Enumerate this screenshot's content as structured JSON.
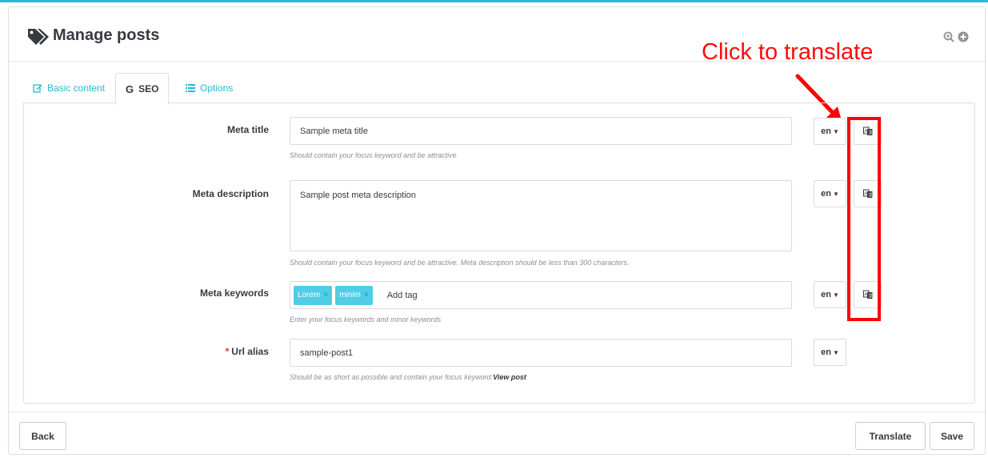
{
  "header": {
    "title": "Manage posts",
    "title_icon": "tags-icon",
    "actions": [
      {
        "icon": "zoom-icon"
      },
      {
        "icon": "plus-circle-icon"
      }
    ]
  },
  "annotation": {
    "text": "Click to translate",
    "color": "#ff0a0a"
  },
  "tabs": [
    {
      "label": "Basic content",
      "icon": "edit-icon",
      "active": false
    },
    {
      "label": "SEO",
      "icon": "google-icon",
      "active": true
    },
    {
      "label": "Options",
      "icon": "list-icon",
      "active": false
    }
  ],
  "fields": {
    "meta_title": {
      "label": "Meta title",
      "value": "Sample meta title",
      "help": "Should contain your focus keyword and be attractive",
      "lang": "en"
    },
    "meta_description": {
      "label": "Meta description",
      "value": "Sample post meta description",
      "help": "Should contain your focus keyword and be attractive. Meta description should be less than 300 characters.",
      "lang": "en"
    },
    "meta_keywords": {
      "label": "Meta keywords",
      "tags": [
        "Lorem",
        "minim"
      ],
      "placeholder": "Add tag",
      "help": "Enter your focus keywords and minor keywords",
      "lang": "en"
    },
    "url_alias": {
      "label": "Url alias",
      "required_mark": "*",
      "value": "sample-post1",
      "help": "Should be as short as possible and contain your focus keyword.",
      "help_link": "View post",
      "lang": "en"
    }
  },
  "footer": {
    "back_label": "Back",
    "translate_label": "Translate",
    "save_label": "Save"
  },
  "colors": {
    "accent": "#25b9d7",
    "tag_bg": "#4fcde6",
    "highlight": "#ff0000"
  }
}
